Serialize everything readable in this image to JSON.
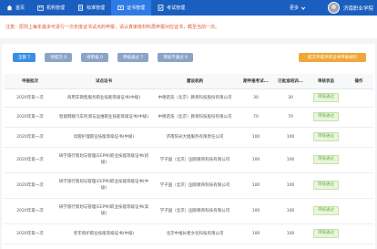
{
  "nav": {
    "items": [
      {
        "label": "首页",
        "icon": "home-icon"
      },
      {
        "label": "机构管理",
        "icon": "org-icon"
      },
      {
        "label": "标准管理",
        "icon": "standard-icon"
      },
      {
        "label": "证书管理",
        "icon": "certificate-icon",
        "active": true
      },
      {
        "label": "考试管理",
        "icon": "exam-icon"
      }
    ],
    "more_label": "更多",
    "school_name": "济南职业学院"
  },
  "notice": "注意：原则上每年最多可进行一次年度证书试点的申报，请认真审核材料再申报对应证书，截至当前一次。",
  "filters": [
    {
      "label": "全部 7",
      "active": true
    },
    {
      "label": "待提交 0"
    },
    {
      "label": "待审核 0"
    },
    {
      "label": "审核通过 7"
    },
    {
      "label": "审核不通过 0"
    }
  ],
  "summary_button": "提交专家评审证书申报材料",
  "table": {
    "headers": [
      "申报批次",
      "试点证书",
      "建设机构",
      "期申报考试...",
      "已批准培训...",
      "审核状态",
      "操作"
    ],
    "rows": [
      {
        "batch": "2020年第一次",
        "cert": "商用车销售服务职业技能等级证书(中级)",
        "org": "中德诺浩（北京）教育科技股份有限公司",
        "a": "30",
        "b": "30",
        "status": "审核通过"
      },
      {
        "batch": "2020年第一次",
        "cert": "智能网联汽车检测与运维职业技能等级证书(中级)",
        "org": "中德诺浩（北京）教育科技股份有限公司",
        "a": "70",
        "b": "70",
        "status": "审核通过"
      },
      {
        "batch": "2020年第一次",
        "cert": "母婴护理职业技能等级证书(中级)",
        "org": "济南阳光大姐服务有限责任公司",
        "a": "100",
        "b": "100",
        "status": "审核通过"
      },
      {
        "batch": "2020年第一次",
        "cert": "研学旅行策划与管理(EEPM)职业技能等级证书(初级)",
        "org": "学子国（北京）国际教育科技有限公司",
        "a": "100",
        "b": "100",
        "status": "审核通过"
      },
      {
        "batch": "2020年第一次",
        "cert": "研学旅行策划与管理(EEPM)职业技能等级证书(中级)",
        "org": "学子国（北京）国际教育科技有限公司",
        "a": "100",
        "b": "100",
        "status": "审核通过"
      },
      {
        "batch": "2020年第一次",
        "cert": "研学旅行策划与管理(EEPM)职业技能等级证书(高级)",
        "org": "学子国（北京）国际教育科技有限公司",
        "a": "100",
        "b": "100",
        "status": "审核通过"
      },
      {
        "batch": "2020年第一次",
        "cert": "老年照护职业技能等级证书(中级)",
        "org": "北京中福长者文化科技有限公司",
        "a": "100",
        "b": "100",
        "status": "审核通过"
      }
    ]
  },
  "colors": {
    "nav_bg": "#1a5fbf",
    "nav_active": "#2f7be6",
    "notice": "#e0582f",
    "summary_btn": "#f0a73a",
    "status_ok": "#67b041"
  }
}
